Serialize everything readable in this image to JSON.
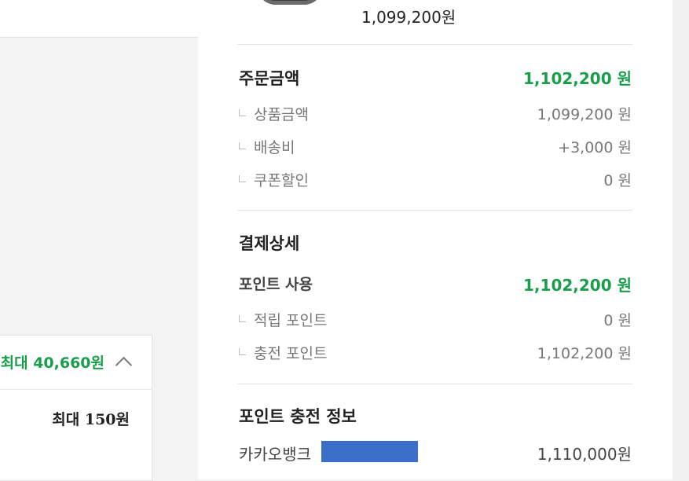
{
  "left": {
    "reward_total": "최대 40,660원",
    "reward_item": "최대 150원"
  },
  "product": {
    "price": "1,099,200원"
  },
  "order": {
    "title": "주문금액",
    "total": "1,102,200 원",
    "rows": [
      {
        "label": "상품금액",
        "value": "1,099,200 원"
      },
      {
        "label": "배송비",
        "value": "+3,000 원"
      },
      {
        "label": "쿠폰할인",
        "value": "0 원"
      }
    ]
  },
  "payment": {
    "title": "결제상세",
    "point_use_label": "포인트 사용",
    "point_use_total": "1,102,200 원",
    "rows": [
      {
        "label": "적립 포인트",
        "value": "0 원"
      },
      {
        "label": "충전 포인트",
        "value": "1,102,200 원"
      }
    ]
  },
  "charge": {
    "title": "포인트 충전 정보",
    "bank_label": "카카오뱅크",
    "amount": "1,110,000원",
    "masked_color": "#3a6fc9"
  },
  "colors": {
    "accent_green": "#1a9e4d"
  }
}
